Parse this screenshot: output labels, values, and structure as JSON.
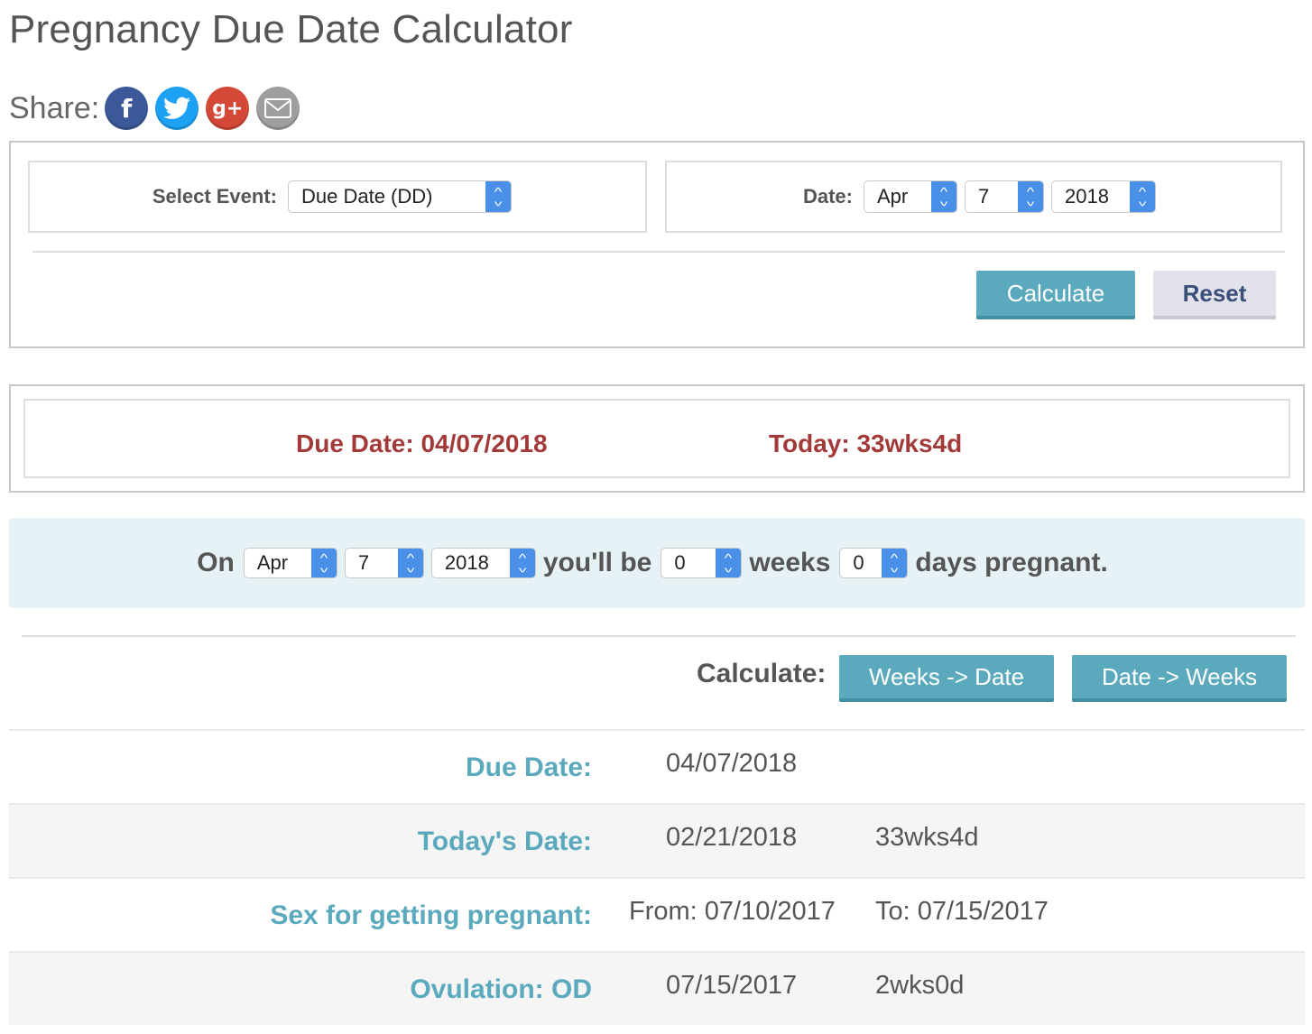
{
  "page_title": "Pregnancy Due Date Calculator",
  "share": {
    "label": "Share:",
    "buttons": [
      {
        "name": "facebook",
        "glyph": "f",
        "color": "#3b5998"
      },
      {
        "name": "twitter",
        "glyph": "t",
        "color": "#1da1f2"
      },
      {
        "name": "google-plus",
        "glyph": "g+",
        "color": "#d34836"
      },
      {
        "name": "email",
        "glyph": "✉",
        "color": "#9e9e9e"
      }
    ]
  },
  "form": {
    "event_label": "Select Event:",
    "event_value": "Due Date (DD)",
    "date_label": "Date:",
    "date_month": "Apr",
    "date_day": "7",
    "date_year": "2018",
    "calculate_label": "Calculate",
    "reset_label": "Reset"
  },
  "result": {
    "due_date_text": "Due Date: 04/07/2018",
    "today_text": "Today: 33wks4d"
  },
  "converter": {
    "on_label": "On",
    "month": "Apr",
    "day": "7",
    "year": "2018",
    "youll_be_label": "you'll be",
    "weeks_value": "0",
    "weeks_label": "weeks",
    "days_value": "0",
    "days_label": "days pregnant.",
    "calculate_label": "Calculate:",
    "weeks_to_date_label": "Weeks -> Date",
    "date_to_weeks_label": "Date -> Weeks"
  },
  "table": {
    "rows": [
      {
        "label": "Due Date:",
        "value1": "04/07/2018",
        "value2": ""
      },
      {
        "label": "Today's Date:",
        "value1": "02/21/2018",
        "value2": "33wks4d"
      },
      {
        "label": "Sex for getting pregnant:",
        "value1": "From: 07/10/2017",
        "value2": "To: 07/15/2017"
      },
      {
        "label": "Ovulation: OD",
        "value1": "07/15/2017",
        "value2": "2wks0d"
      }
    ]
  },
  "colors": {
    "accent": "#5aa9bd",
    "result_red": "#a33a3a",
    "band_bg": "#e6f2f6",
    "select_arrow": "#4a8fe8"
  }
}
